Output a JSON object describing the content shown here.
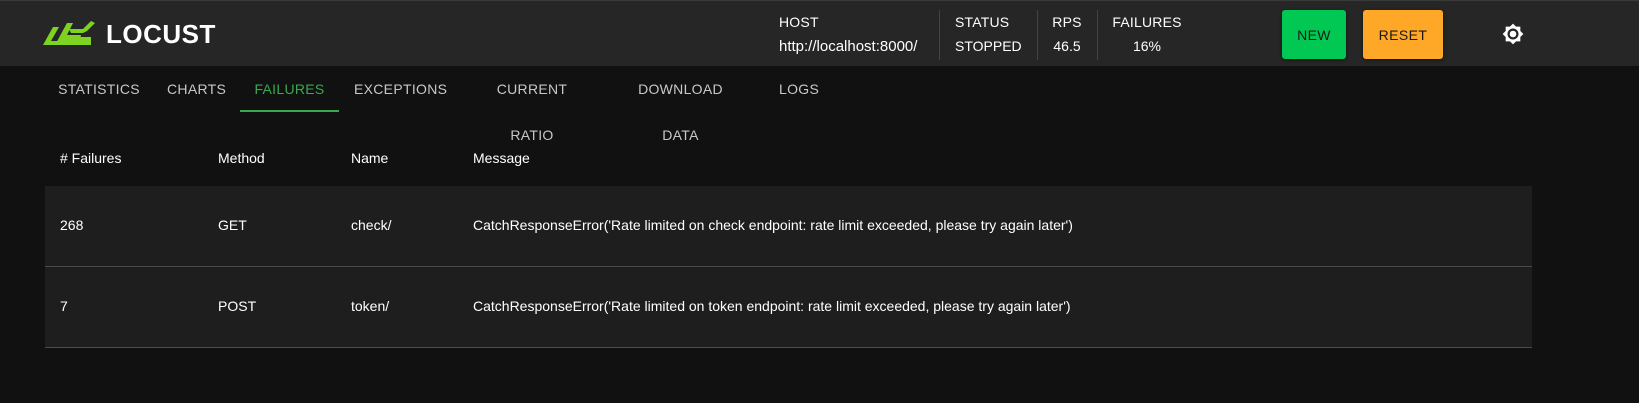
{
  "app": {
    "logo_text": "LOCUST",
    "logo_color": "#7ed321"
  },
  "header": {
    "host": {
      "label": "HOST",
      "value": "http://localhost:8000/"
    },
    "status": {
      "label": "STATUS",
      "value": "STOPPED"
    },
    "rps": {
      "label": "RPS",
      "value": "46.5"
    },
    "failures": {
      "label": "FAILURES",
      "value": "16%"
    },
    "new_button": {
      "label": "NEW",
      "color": "#00c853"
    },
    "reset_button": {
      "label": "RESET",
      "color": "#ffa726"
    },
    "theme_toggle_icon": "sun-icon"
  },
  "tabs": [
    {
      "label": "STATISTICS"
    },
    {
      "label": "CHARTS"
    },
    {
      "label": "FAILURES",
      "active": true
    },
    {
      "label": "EXCEPTIONS"
    },
    {
      "label": "CURRENT RATIO"
    },
    {
      "label": "DOWNLOAD DATA"
    },
    {
      "label": "LOGS"
    }
  ],
  "accent_color": "#3aa84f",
  "failures_table": {
    "columns": [
      "# Failures",
      "Method",
      "Name",
      "Message"
    ],
    "rows": [
      {
        "failures": "268",
        "method": "GET",
        "name": "check/",
        "message": "CatchResponseError('Rate limited on check endpoint: rate limit exceeded, please try again later')"
      },
      {
        "failures": "7",
        "method": "POST",
        "name": "token/",
        "message": "CatchResponseError('Rate limited on token endpoint: rate limit exceeded, please try again later')"
      }
    ]
  }
}
